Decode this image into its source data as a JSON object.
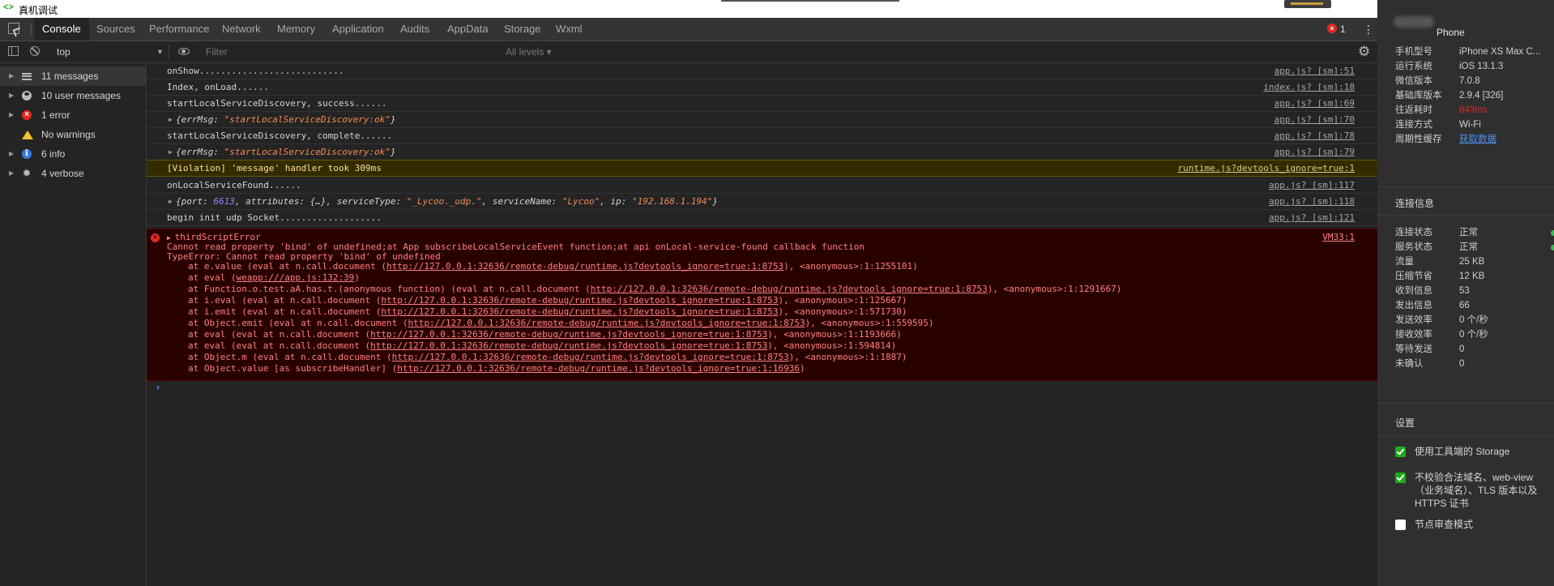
{
  "window": {
    "logo": "<>",
    "title": "真机调试",
    "controls": {
      "minimize": "—",
      "maximize": "❐",
      "close": "✕"
    }
  },
  "tabs": [
    "Console",
    "Sources",
    "Performance",
    "Network",
    "Memory",
    "Application",
    "Audits",
    "AppData",
    "Storage",
    "Wxml"
  ],
  "active_tab": "Console",
  "error_badge": {
    "count": "1"
  },
  "filterbar": {
    "context": "top",
    "filter_placeholder": "Filter",
    "levels": "All levels ▾"
  },
  "sidebar": {
    "items": [
      {
        "label": "11 messages",
        "icon": "list-icon",
        "selected": true
      },
      {
        "label": "10 user messages",
        "icon": "user-icon"
      },
      {
        "label": "1 error",
        "icon": "error-icon"
      },
      {
        "label": "No warnings",
        "icon": "warning-icon"
      },
      {
        "label": "6 info",
        "icon": "info-icon"
      },
      {
        "label": "4 verbose",
        "icon": "verbose-icon"
      }
    ]
  },
  "console": {
    "rows": [
      {
        "text": "onShow...........................",
        "src": "app.js? [sm]:51"
      },
      {
        "text": "Index, onLoad......",
        "src": "index.js? [sm]:18"
      },
      {
        "text": "startLocalServiceDiscovery, success......",
        "src": "app.js? [sm]:69"
      },
      {
        "obj_key": "errMsg",
        "obj_val": "\"startLocalServiceDiscovery:ok\"",
        "src": "app.js? [sm]:70"
      },
      {
        "text": "startLocalServiceDiscovery, complete......",
        "src": "app.js? [sm]:78"
      },
      {
        "obj_key": "errMsg",
        "obj_val": "\"startLocalServiceDiscovery:ok\"",
        "src": "app.js? [sm]:79"
      },
      {
        "text": "[Violation] 'message' handler took 309ms",
        "src": "runtime.js?devtools_ignore=true:1"
      },
      {
        "text": "onLocalServiceFound......",
        "src": "app.js? [sm]:117"
      },
      {
        "found": {
          "port": "6613",
          "attributes": "{…}",
          "serviceType": "\"_Lycoo._udp.\"",
          "serviceName": "\"Lycoo\"",
          "ip": "\"192.168.1.194\""
        },
        "src": "app.js? [sm]:118"
      },
      {
        "text": "begin init udp Socket...................",
        "src": "app.js? [sm]:121"
      }
    ],
    "error": {
      "title": "thirdScriptError",
      "src": "VM33:1",
      "message": "Cannot read property 'bind' of undefined;at App subscribeLocalServiceEvent function;at api onLocal-service-found callback function",
      "type_error": "TypeError: Cannot read property 'bind' of undefined",
      "stack": [
        {
          "pre": "at e.value (eval at n.call.document (",
          "url": "http://127.0.0.1:32636/remote-debug/runtime.js?devtools_ignore=true:1:8753",
          "post": "), <anonymous>:1:1255101)"
        },
        {
          "pre": "at eval (",
          "url": "weapp:///app.js:132:39",
          "post": ")"
        },
        {
          "pre": "at Function.o.test.aA.has.t.(anonymous function) (eval at n.call.document (",
          "url": "http://127.0.0.1:32636/remote-debug/runtime.js?devtools_ignore=true:1:8753",
          "post": "), <anonymous>:1:1291667)"
        },
        {
          "pre": "at i.eval (eval at n.call.document (",
          "url": "http://127.0.0.1:32636/remote-debug/runtime.js?devtools_ignore=true:1:8753",
          "post": "), <anonymous>:1:125667)"
        },
        {
          "pre": "at i.emit (eval at n.call.document (",
          "url": "http://127.0.0.1:32636/remote-debug/runtime.js?devtools_ignore=true:1:8753",
          "post": "), <anonymous>:1:571730)"
        },
        {
          "pre": "at Object.emit (eval at n.call.document (",
          "url": "http://127.0.0.1:32636/remote-debug/runtime.js?devtools_ignore=true:1:8753",
          "post": "), <anonymous>:1:559595)"
        },
        {
          "pre": "at eval (eval at n.call.document (",
          "url": "http://127.0.0.1:32636/remote-debug/runtime.js?devtools_ignore=true:1:8753",
          "post": "), <anonymous>:1:1193666)"
        },
        {
          "pre": "at eval (eval at n.call.document (",
          "url": "http://127.0.0.1:32636/remote-debug/runtime.js?devtools_ignore=true:1:8753",
          "post": "), <anonymous>:1:594814)"
        },
        {
          "pre": "at Object.m (eval at n.call.document (",
          "url": "http://127.0.0.1:32636/remote-debug/runtime.js?devtools_ignore=true:1:8753",
          "post": "), <anonymous>:1:1887)"
        },
        {
          "pre": "at Object.value [as subscribeHandler] (",
          "url": "http://127.0.0.1:32636/remote-debug/runtime.js?devtools_ignore=true:1:16936",
          "post": ")"
        }
      ]
    },
    "prompt": "›"
  },
  "right_panel": {
    "device": "Phone",
    "info": [
      {
        "k": "手机型号",
        "v": "iPhone XS Max C..."
      },
      {
        "k": "运行系统",
        "v": "iOS 13.1.3"
      },
      {
        "k": "微信版本",
        "v": "7.0.8"
      },
      {
        "k": "基础库版本",
        "v": "2.9.4 [326]"
      },
      {
        "k": "往返耗时",
        "v": "843ms",
        "style": "red"
      },
      {
        "k": "连接方式",
        "v": "Wi-Fi"
      },
      {
        "k": "周期性缓存",
        "v": "获取数据",
        "style": "link"
      }
    ],
    "conn_title": "连接信息",
    "conn": [
      {
        "k": "连接状态",
        "v": "正常",
        "dot": true
      },
      {
        "k": "服务状态",
        "v": "正常",
        "dot": true
      },
      {
        "k": "流量",
        "v": "25 KB"
      },
      {
        "k": "压缩节省",
        "v": "12 KB"
      },
      {
        "k": "收到信息",
        "v": "53"
      },
      {
        "k": "发出信息",
        "v": "66"
      },
      {
        "k": "发送效率",
        "v": "0 个/秒"
      },
      {
        "k": "接收效率",
        "v": "0 个/秒"
      },
      {
        "k": "等待发送",
        "v": "0"
      },
      {
        "k": "未确认",
        "v": "0"
      }
    ],
    "settings_title": "设置",
    "settings": [
      {
        "label": "使用工具端的 Storage",
        "checked": true
      },
      {
        "label": "不校验合法域名、web-view（业务域名）、TLS 版本以及 HTTPS 证书",
        "checked": true
      },
      {
        "label": "节点审查模式",
        "checked": false
      }
    ]
  },
  "colors": {
    "console_bg": "#242424",
    "error_bg": "#290000",
    "error_text": "#ff8080",
    "warning_bg": "#332b00",
    "accent_green": "#1aad19",
    "link_blue": "#4d8ff0"
  }
}
